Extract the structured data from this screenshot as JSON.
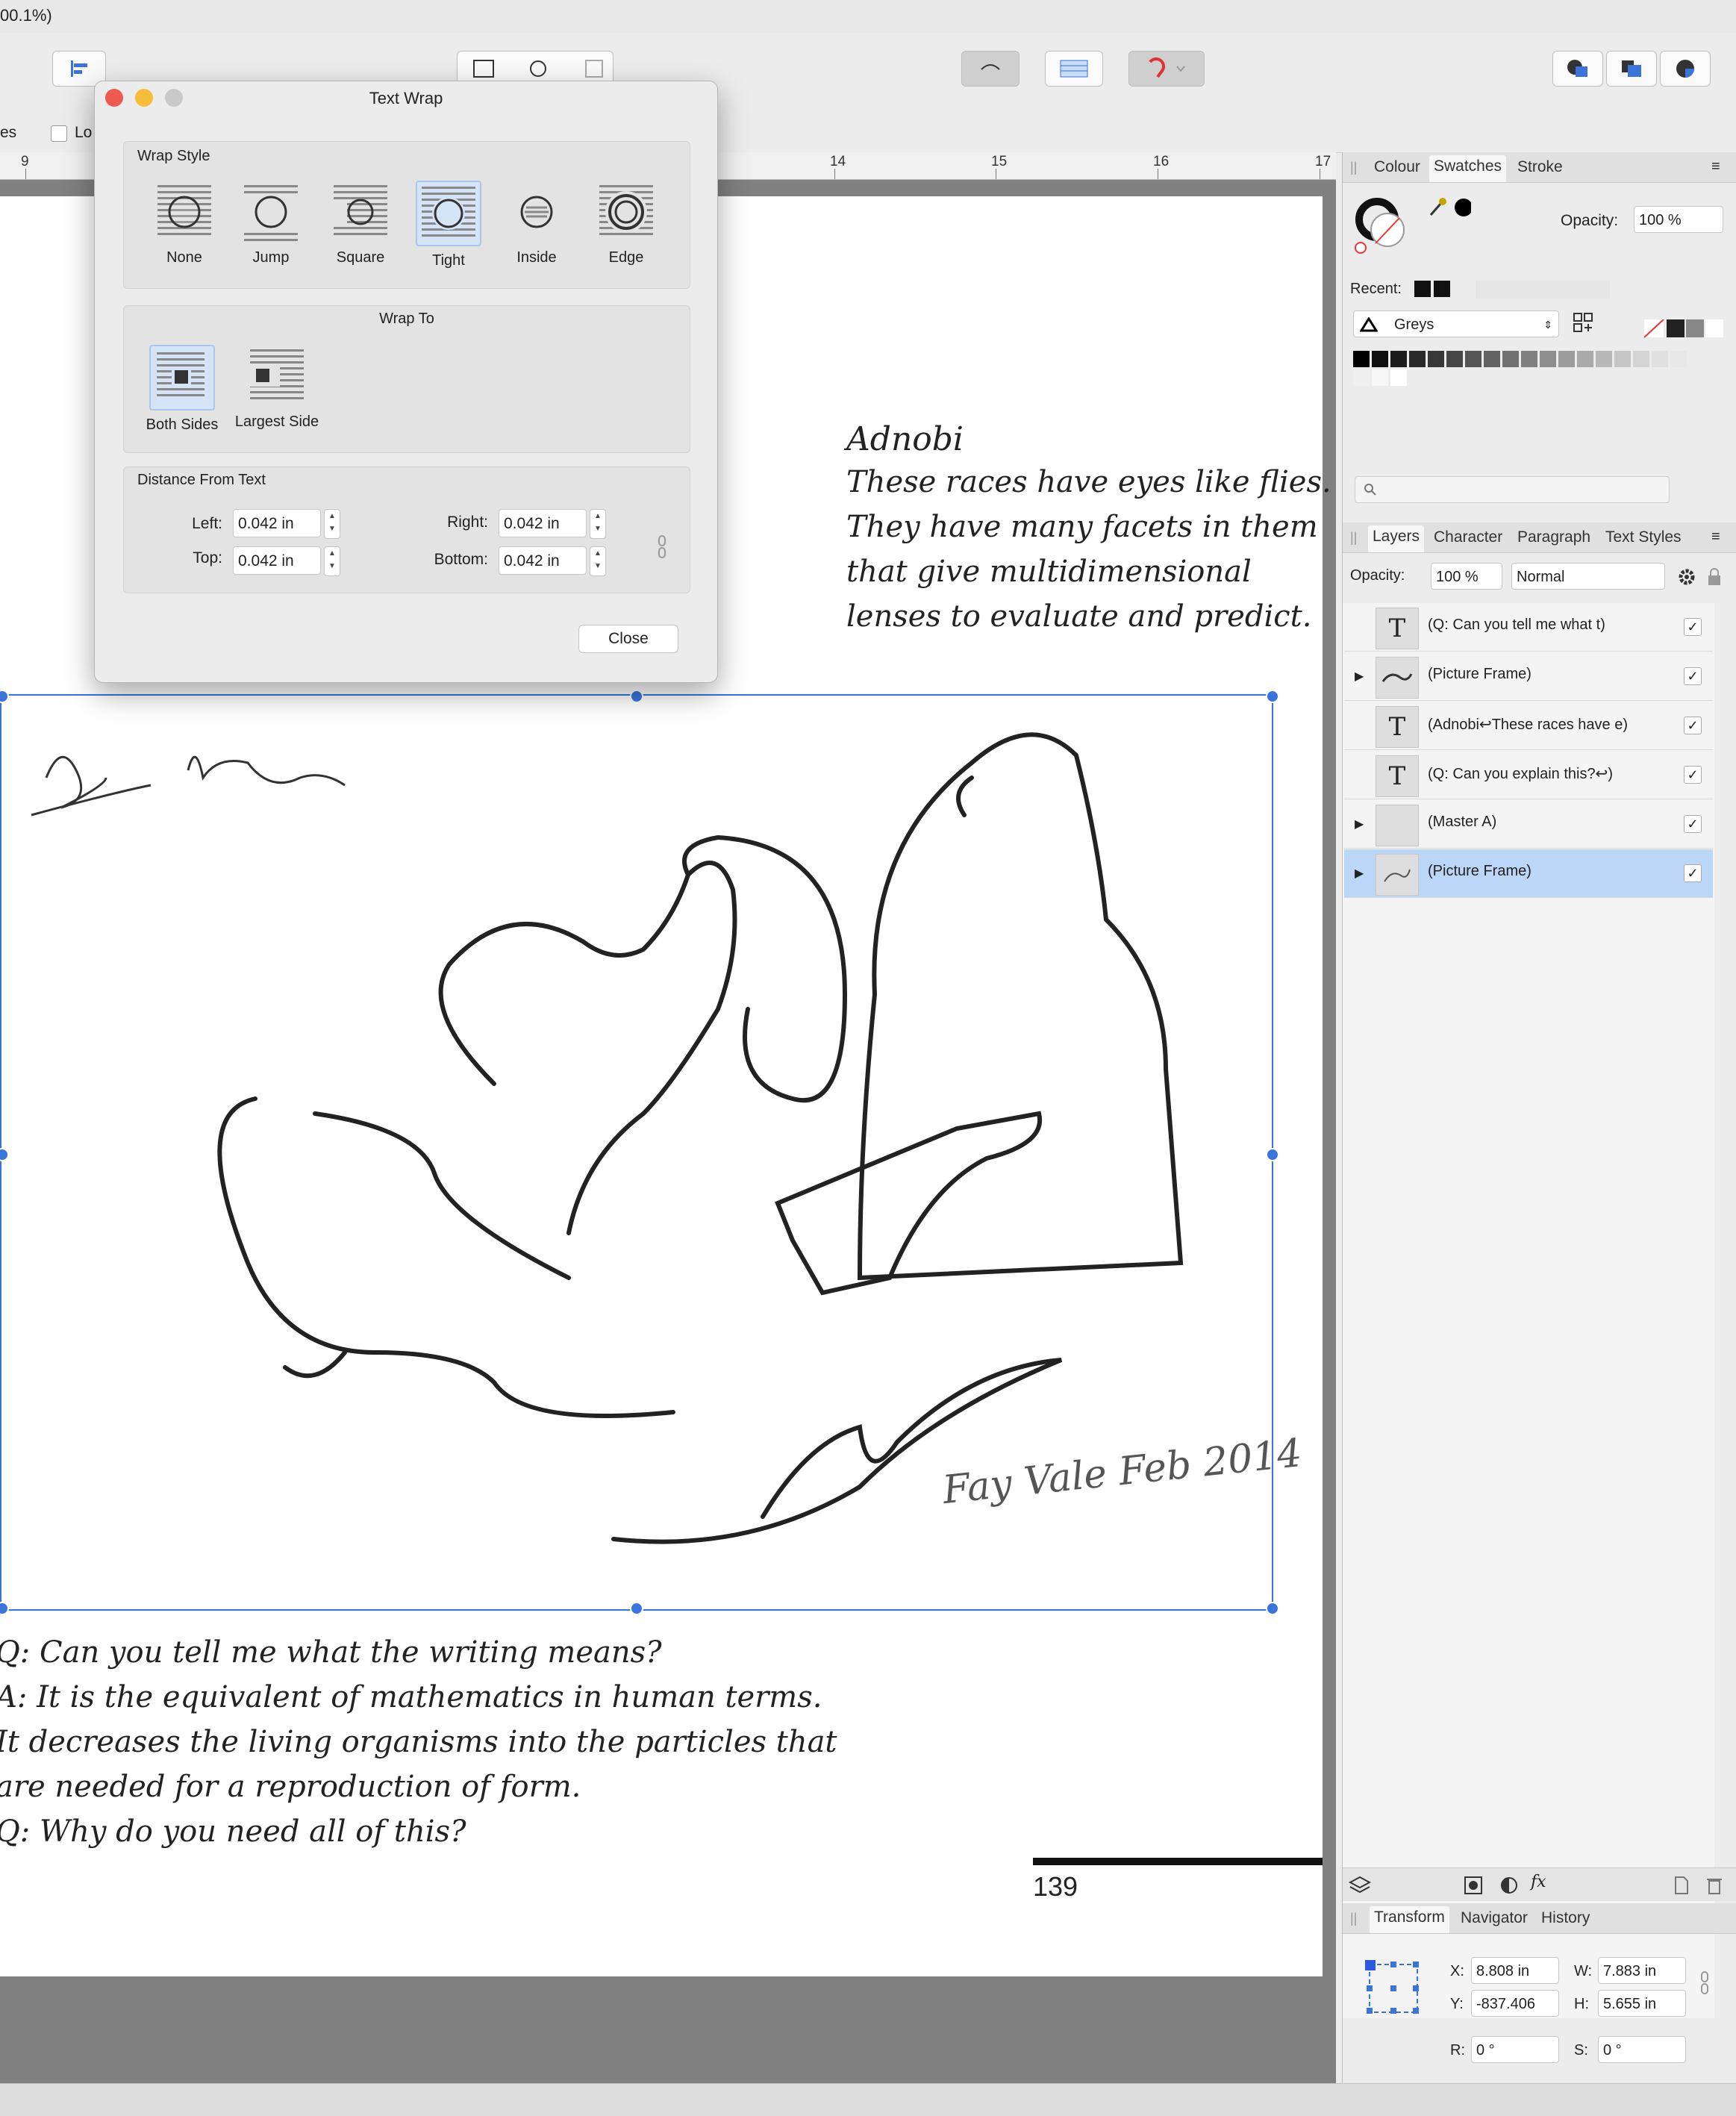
{
  "window": {
    "title_fragment": "00.1%)"
  },
  "context_bar": {
    "left_fragment": "es",
    "checkbox_label_fragment": "Lo"
  },
  "ruler": {
    "labels": [
      "9",
      "14",
      "15",
      "16",
      "17"
    ]
  },
  "dialog": {
    "title": "Text Wrap",
    "wrap_style": {
      "title": "Wrap Style",
      "options": [
        "None",
        "Jump",
        "Square",
        "Tight",
        "Inside",
        "Edge"
      ],
      "selected": "Tight"
    },
    "wrap_to": {
      "title": "Wrap To",
      "options": [
        "Both Sides",
        "Largest Side"
      ],
      "selected": "Both Sides"
    },
    "distance": {
      "title": "Distance From Text",
      "left_label": "Left:",
      "left_value": "0.042 in",
      "right_label": "Right:",
      "right_value": "0.042 in",
      "top_label": "Top:",
      "top_value": "0.042 in",
      "bottom_label": "Bottom:",
      "bottom_value": "0.042 in"
    },
    "close_label": "Close"
  },
  "document": {
    "poem": [
      "Adnobi",
      "These races have eyes like flies.",
      "They have many facets in them",
      "that give multidimensional",
      "lenses to evaluate and predict."
    ],
    "qa": [
      "Q: Can you tell me what the writing means?",
      "A: It is the equivalent of mathematics in human terms.",
      "It decreases the living organisms into the particles that",
      "are needed for a reproduction of form.",
      "Q: Why do you need all of this?"
    ],
    "page_number": "139",
    "signature": "Fay Vale Feb 2014"
  },
  "colour_panel": {
    "tabs": [
      "Colour",
      "Swatches",
      "Stroke"
    ],
    "active_tab": "Swatches",
    "opacity_label": "Opacity:",
    "opacity_value": "100 %",
    "recent_label": "Recent:",
    "palette_name": "Greys"
  },
  "layers_panel": {
    "tabs": [
      "Layers",
      "Character",
      "Paragraph",
      "Text Styles"
    ],
    "active_tab": "Layers",
    "opacity_label": "Opacity:",
    "opacity_value": "100 %",
    "blend_mode": "Normal",
    "layers": [
      {
        "name": "(Q: Can you tell me what t)",
        "type": "text",
        "expandable": false,
        "selected": false
      },
      {
        "name": "(Picture Frame)",
        "type": "picture",
        "expandable": true,
        "selected": false
      },
      {
        "name": "(Adnobi↩These races have e)",
        "type": "text",
        "expandable": false,
        "selected": false
      },
      {
        "name": "(Q: Can you explain this?↩)",
        "type": "text",
        "expandable": false,
        "selected": false
      },
      {
        "name": "(Master A)",
        "type": "master",
        "expandable": true,
        "selected": false
      },
      {
        "name": "(Picture Frame)",
        "type": "picture",
        "expandable": true,
        "selected": true
      }
    ]
  },
  "transform_panel": {
    "tabs": [
      "Transform",
      "Navigator",
      "History"
    ],
    "active_tab": "Transform",
    "x_label": "X:",
    "x_value": "8.808 in",
    "y_label": "Y:",
    "y_value": "-837.406",
    "w_label": "W:",
    "w_value": "7.883 in",
    "h_label": "H:",
    "h_value": "5.655 in",
    "r_label": "R:",
    "r_value": "0 °",
    "s_label": "S:",
    "s_value": "0 °"
  },
  "colors": {
    "accent": "#3a74d8",
    "selection": "#bcd6f7",
    "canvas": "#808080"
  }
}
